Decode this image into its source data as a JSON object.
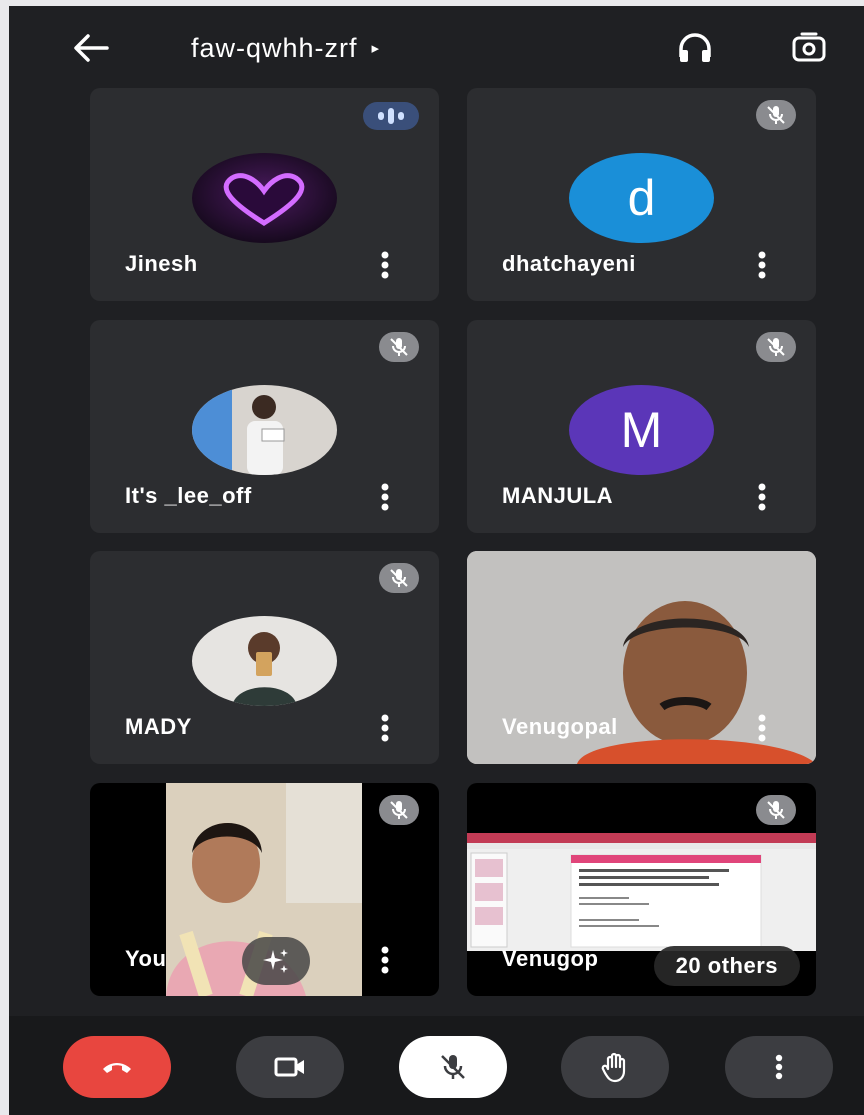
{
  "header": {
    "meeting_code": "faw-qwhh-zrf",
    "caret": "▸"
  },
  "tiles": [
    {
      "name": "Jinesh",
      "status": "speaking"
    },
    {
      "name": "dhatchayeni",
      "avatar_letter": "d",
      "avatar_color": "#1a8fd8",
      "status": "muted"
    },
    {
      "name": "It's _lee_off",
      "status": "muted"
    },
    {
      "name": "MANJULA",
      "avatar_letter": "M",
      "avatar_color": "#5b36b8",
      "status": "muted"
    },
    {
      "name": "MADY",
      "status": "muted"
    },
    {
      "name": "Venugopal",
      "status": "video"
    },
    {
      "name": "You",
      "status": "muted"
    },
    {
      "name": "Venugop",
      "others_label": "20 others",
      "status": "muted"
    }
  ],
  "colors": {
    "end_call": "#e8463f",
    "background": "#1f2023",
    "tile": "#2c2d30"
  },
  "icons": {
    "back": "arrow-left-icon",
    "audio": "headphones-icon",
    "flip": "camera-flip-icon",
    "end": "phone-hangup-icon",
    "camera": "video-camera-icon",
    "mic": "mic-off-icon",
    "hand": "raise-hand-icon",
    "more": "more-vertical-icon"
  }
}
